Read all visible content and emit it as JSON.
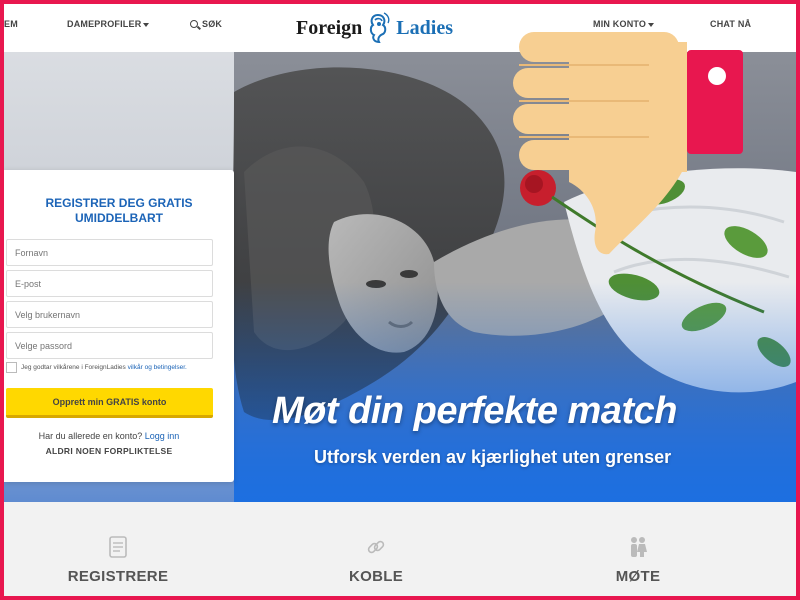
{
  "nav": {
    "item_edge": "EM",
    "profiles": "DAMEPROFILER",
    "search": "SØK",
    "account": "MIN KONTO",
    "chat": "CHAT NÅ"
  },
  "logo": {
    "part1": "Foreign",
    "part2": "Ladies"
  },
  "signup": {
    "title_line1": "REGISTRER DEG GRATIS",
    "title_line2": "UMIDDELBART",
    "first_name_placeholder": "Fornavn",
    "email_placeholder": "E-post",
    "username_placeholder": "Velg brukernavn",
    "password_placeholder": "Velge passord",
    "terms_prefix": "Jeg godtar vilkårene i ForeignLadies",
    "terms_link": "vilkår og betingelser.",
    "submit_label": "Opprett min GRATIS konto",
    "have_account": "Har du allerede en konto?",
    "login_link": "Logg inn",
    "no_commitment": "ALDRI NOEN FORPLIKTELSE"
  },
  "hero": {
    "headline": "Møt din perfekte match",
    "subheadline": "Utforsk verden av kjærlighet uten grenser"
  },
  "steps": [
    {
      "label": "REGISTRERE",
      "icon": "document-icon"
    },
    {
      "label": "KOBLE",
      "icon": "link-icon"
    },
    {
      "label": "MØTE",
      "icon": "couple-icon"
    }
  ],
  "colors": {
    "frame_border": "#e8174f",
    "brand_blue": "#1c64b7",
    "cta_yellow": "#ffd800",
    "thumb_skin": "#f7cf92",
    "thumb_cuff": "#e8174f"
  }
}
